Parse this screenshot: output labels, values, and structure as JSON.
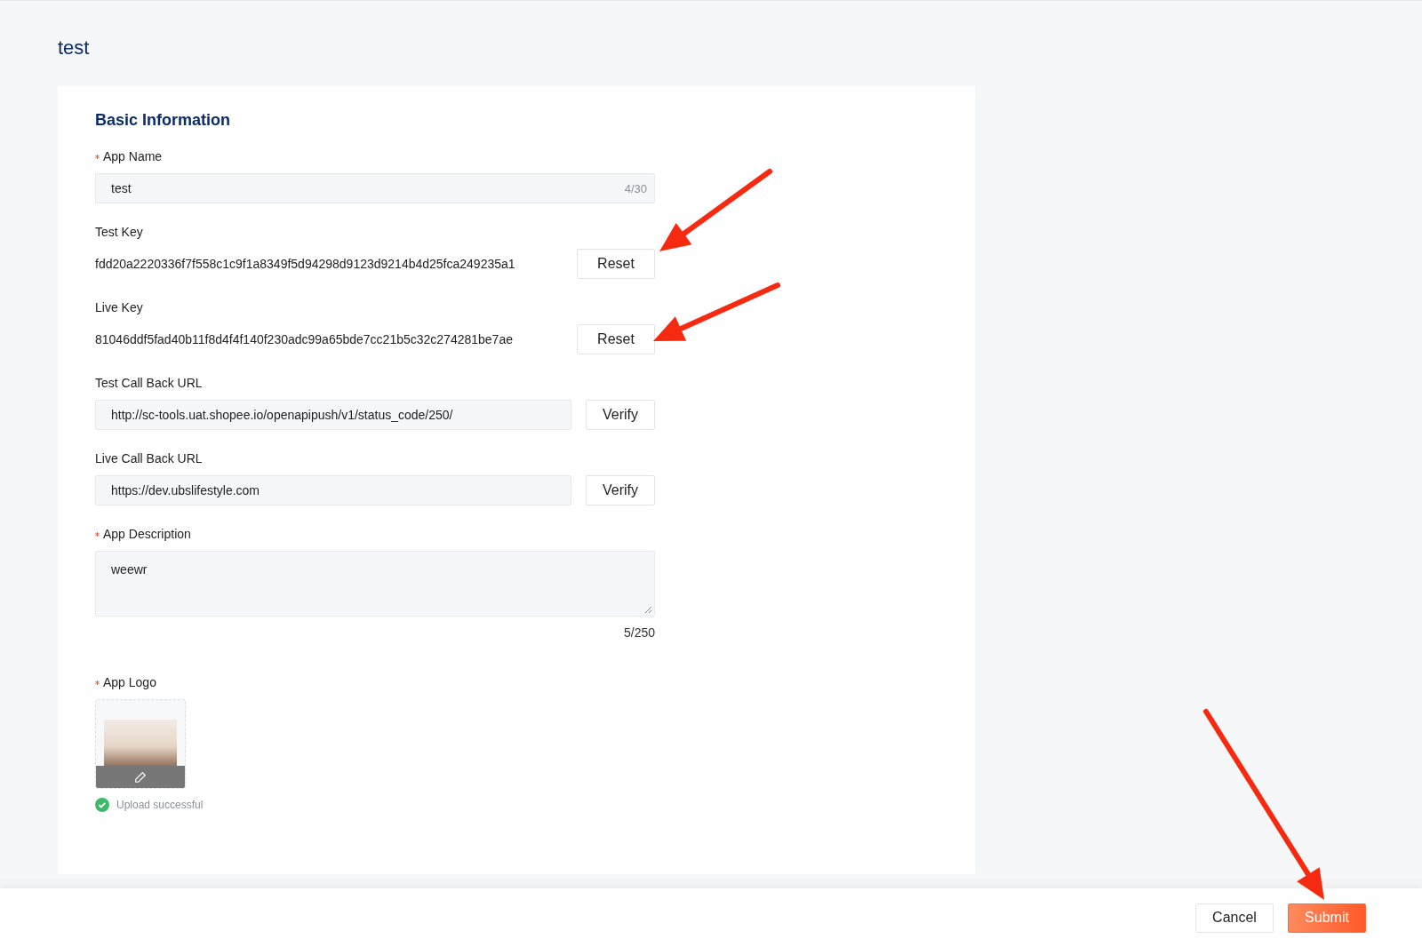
{
  "page": {
    "title": "test"
  },
  "section": {
    "title": "Basic Information"
  },
  "fields": [
    {
      "kind": "input",
      "label": "App Name",
      "required": true,
      "value": "test",
      "counter": "4/30"
    },
    {
      "kind": "key",
      "label": "Test Key",
      "required": false,
      "value": "fdd20a2220336f7f558c1c9f1a8349f5d94298d9123d9214b4d25fca249235a1",
      "button": "Reset"
    },
    {
      "kind": "key",
      "label": "Live Key",
      "required": false,
      "value": "81046ddf5fad40b11f8d4f4f140f230adc99a65bde7cc21b5c32c274281be7ae",
      "button": "Reset"
    },
    {
      "kind": "url",
      "label": "Test Call Back URL",
      "required": false,
      "value": "http://sc-tools.uat.shopee.io/openapipush/v1/status_code/250/",
      "button": "Verify"
    },
    {
      "kind": "url",
      "label": "Live Call Back URL",
      "required": false,
      "value": "https://dev.ubslifestyle.com",
      "button": "Verify"
    },
    {
      "kind": "textarea",
      "label": "App Description",
      "required": true,
      "value": "weewr",
      "counter": "5/250"
    },
    {
      "kind": "logo",
      "label": "App Logo",
      "required": true,
      "status": "Upload successful"
    }
  ],
  "footer": {
    "buttons": [
      {
        "label": "Cancel",
        "primary": false
      },
      {
        "label": "Submit",
        "primary": true
      }
    ]
  }
}
